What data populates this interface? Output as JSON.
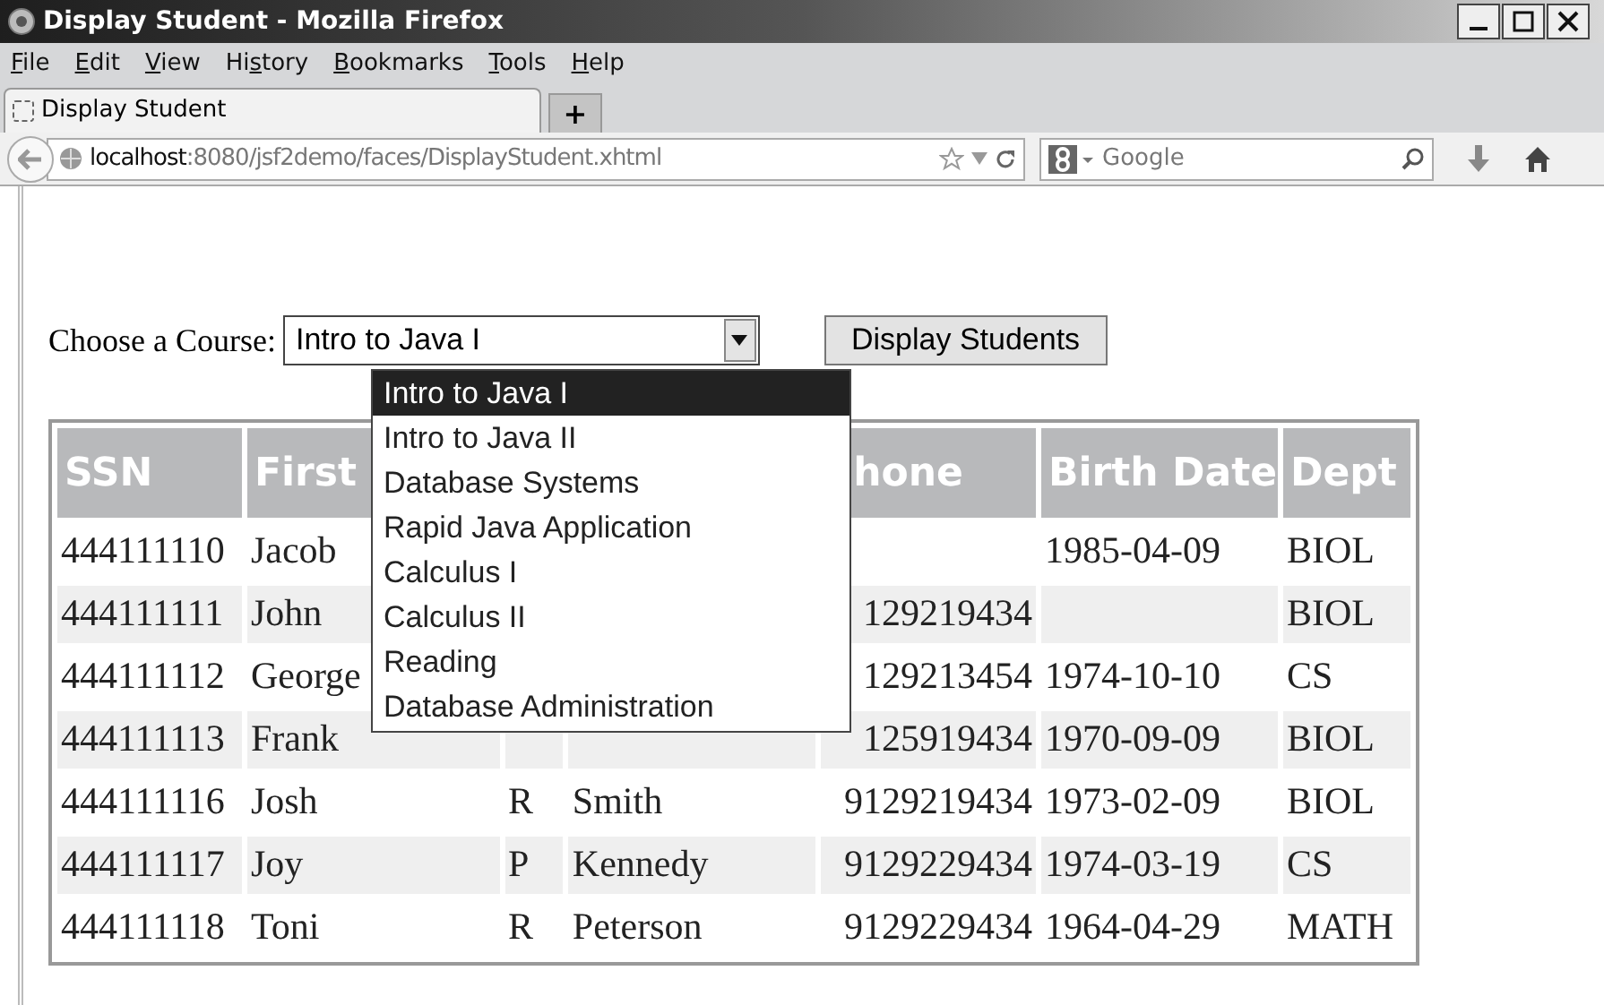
{
  "window": {
    "title": "Display Student - Mozilla Firefox"
  },
  "menu": [
    {
      "key": "F",
      "after": "ile"
    },
    {
      "key": "E",
      "after": "dit"
    },
    {
      "key": "V",
      "after": "iew"
    },
    {
      "before": "Hi",
      "key": "s",
      "after": "tory"
    },
    {
      "key": "B",
      "after": "ookmarks"
    },
    {
      "key": "T",
      "after": "ools"
    },
    {
      "key": "H",
      "after": "elp"
    }
  ],
  "tabs": [
    {
      "title": "Display Student",
      "selected": true
    }
  ],
  "new_tab": "+",
  "address": {
    "host": "localhost",
    "path": ":8080/jsf2demo/faces/DisplayStudent.xhtml"
  },
  "search": {
    "placeholder": "Google"
  },
  "form": {
    "label": "Choose a Course:",
    "select_value": "Intro to Java I",
    "button": "Display Students"
  },
  "dropdown": {
    "expanded": true,
    "options": [
      {
        "label": "Intro to Java I",
        "selected": true
      },
      {
        "label": "Intro to Java II",
        "selected": false
      },
      {
        "label": "Database Systems",
        "selected": false
      },
      {
        "label": "Rapid Java Application",
        "selected": false
      },
      {
        "label": "Calculus I",
        "selected": false
      },
      {
        "label": "Calculus II",
        "selected": false
      },
      {
        "label": "Reading",
        "selected": false
      },
      {
        "label": "Database Administration",
        "selected": false
      }
    ]
  },
  "table": {
    "columns": [
      "SSN",
      "First",
      null,
      null,
      "hone",
      "Birth Date",
      "Dept"
    ],
    "rows": [
      [
        "444111110",
        "Jacob",
        null,
        null,
        null,
        "1985-04-09",
        "BIOL"
      ],
      [
        "444111111",
        "John",
        null,
        null,
        "129219434",
        null,
        "BIOL"
      ],
      [
        "444111112",
        "George",
        null,
        null,
        "129213454",
        "1974-10-10",
        "CS"
      ],
      [
        "444111113",
        "Frank",
        null,
        null,
        "125919434",
        "1970-09-09",
        "BIOL"
      ],
      [
        "444111116",
        "Josh",
        "R",
        "Smith",
        "9129219434",
        "1973-02-09",
        "BIOL"
      ],
      [
        "444111117",
        "Joy",
        "P",
        "Kennedy",
        "9129229434",
        "1974-03-19",
        "CS"
      ],
      [
        "444111118",
        "Toni",
        "R",
        "Peterson",
        "9129229434",
        "1964-04-29",
        "MATH"
      ]
    ]
  }
}
